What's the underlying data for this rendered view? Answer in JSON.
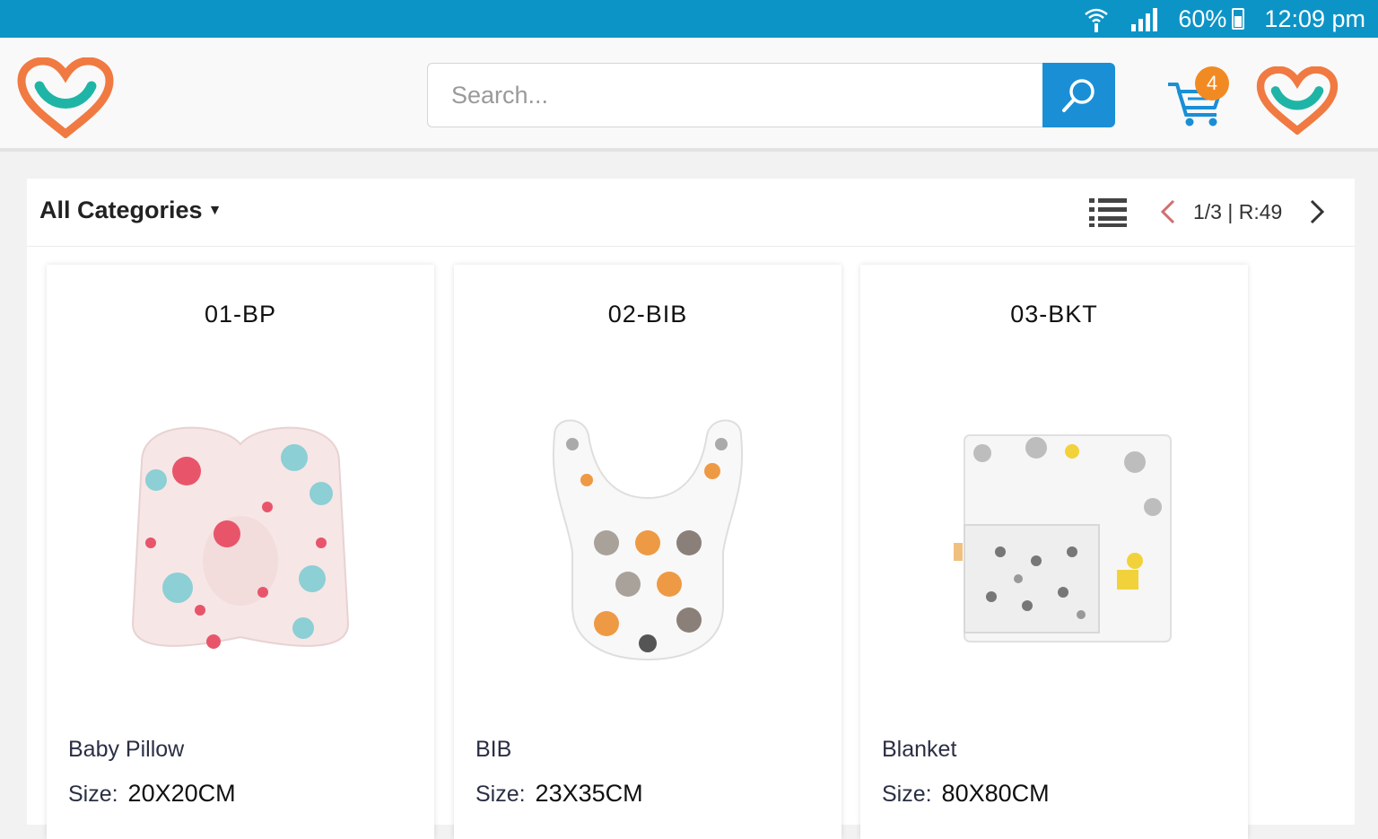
{
  "status_bar": {
    "battery": "60%",
    "time": "12:09 pm"
  },
  "colors": {
    "status_bar": "#0d94c7",
    "search_button": "#1a8fd6",
    "cart_badge": "#f28a23",
    "logo_orange": "#f07a42",
    "logo_teal": "#1fb5a6"
  },
  "header": {
    "search_placeholder": "Search...",
    "cart_count": "4"
  },
  "toolbar": {
    "categories_label": "All Categories",
    "pager_text": "1/3 | R:49"
  },
  "products": [
    {
      "code": "01-BP",
      "name": "Baby Pillow",
      "size_label": "Size:",
      "size_value": "20X20CM"
    },
    {
      "code": "02-BIB",
      "name": "BIB",
      "size_label": "Size:",
      "size_value": "23X35CM"
    },
    {
      "code": "03-BKT",
      "name": "Blanket",
      "size_label": "Size:",
      "size_value": "80X80CM"
    }
  ]
}
